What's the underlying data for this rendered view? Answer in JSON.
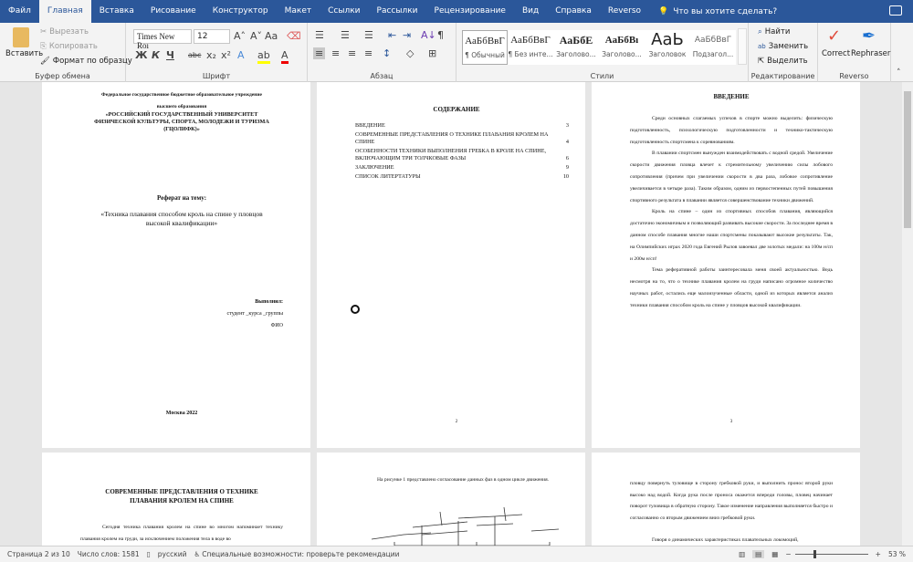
{
  "tabs": [
    "Файл",
    "Главная",
    "Вставка",
    "Рисование",
    "Конструктор",
    "Макет",
    "Ссылки",
    "Рассылки",
    "Рецензирование",
    "Вид",
    "Справка",
    "Reverso"
  ],
  "tell_me": "Что вы хотите сделать?",
  "clipboard": {
    "paste": "Вставить",
    "cut": "Вырезать",
    "copy": "Копировать",
    "format_painter": "Формат по образцу",
    "label": "Буфер обмена"
  },
  "font": {
    "name": "Times New Roı",
    "size": "12",
    "label": "Шрифт",
    "bold": "Ж",
    "italic": "К",
    "underline": "Ч",
    "strike": "abc",
    "sub": "x₂",
    "sup": "x²",
    "grow": "A˄",
    "shrink": "A˅",
    "case": "Aa"
  },
  "paragraph": {
    "label": "Абзац"
  },
  "styles": {
    "label": "Стили",
    "items": [
      {
        "sample": "АаБбВвГ",
        "name": "¶ Обычный"
      },
      {
        "sample": "АаБбВвГ",
        "name": "¶ Без инте..."
      },
      {
        "sample": "АаБбЕ",
        "name": "Заголово..."
      },
      {
        "sample": "АаБбВı",
        "name": "Заголово..."
      },
      {
        "sample": "АаЬ",
        "name": "Заголовок"
      },
      {
        "sample": "АаБбВвГ",
        "name": "Подзагол..."
      }
    ]
  },
  "editing": {
    "label": "Редактирование",
    "find": "Найти",
    "replace": "Заменить",
    "select": "Выделить"
  },
  "reverso": {
    "label": "Reverso",
    "correct": "Correct",
    "rephraser": "Rephraser"
  },
  "page1": {
    "org1": "Федеральное государственное бюджетное образовательное учреждение",
    "org2": "высшего образования",
    "uni1": "«РОССИЙСКИЙ ГОСУДАРСТВЕННЫЙ УНИВЕРСИТЕТ",
    "uni2": "ФИЗИЧЕСКОЙ КУЛЬТУРЫ, СПОРТА, МОЛОДЕЖИ И ТУРИЗМА",
    "uni3": "(ГЦОЛИФК)»",
    "ref": "Реферат на тему:",
    "topic1": "«Техника плавания способом кроль на спине у пловцов",
    "topic2": "высокой квалификации»",
    "done": "Выполнил:",
    "student": "студент _курса _группы",
    "fio": "ФИО",
    "city": "Москва 2022"
  },
  "page2": {
    "title": "СОДЕРЖАНИЕ",
    "toc": [
      {
        "t": "ВВЕДЕНИЕ",
        "p": "3"
      },
      {
        "t": "СОВРЕМЕННЫЕ ПРЕДСТАВЛЕНИЯ О ТЕХНИКЕ ПЛАВАНИЯ КРОЛЕМ НА СПИНЕ",
        "p": "4"
      },
      {
        "t": "ОСОБЕННОСТИ ТЕХНИКИ ВЫПОЛНЕНИЯ ГРЕБКА В КРОЛЕ НА СПИНЕ, ВКЛЮЧАЮЩИМ ТРИ ТОЛЧКОВЫЕ ФАЗЫ",
        "p": "6"
      },
      {
        "t": "ЗАКЛЮЧЕНИЕ",
        "p": "9"
      },
      {
        "t": "СПИСОК ЛИТЕРТАТУРЫ",
        "p": "10"
      }
    ],
    "num": "2"
  },
  "page3": {
    "title": "ВВЕДЕНИЕ",
    "paras": [
      "Среди основных слагаемых успехов в спорте можно выделить: физическую подготовленность, психологическую подготовленности и технико-тактическую подготовленность спортсмена к соревнованиям.",
      "В плавании спортсмен вынужден взаимодействовать с водной средой. Увеличение скорости движения пловца влечет к стремительному увеличению силы лобового сопротивления (причем при увеличении скорости в два раза, лобовое сопротивление увеличивается в четыре раза). Таким образом, одним из первостепенных путей повышения спортивного результата в плавании является совершенствование техники движений.",
      "Кроль на спине – один из спортивных способов плавания, являющийся достаточно экономичным и позволяющий развивать высокие скорости. За последнее время в данном способе плавания многие наши спортсмены показывают высокие результаты. Так, на Олимпийских играх 2020 года Евгений Рылов завоевал две золотых медали: на 100м н/сп и 200м н/сп!",
      "Тема реферативной работы заинтересовала меня своей актуальностью. Ведь несмотря на то, что о технике плавания кролем на груди написано огромное количество научных работ, остались еще малоизученные области, одной из которых является анализ техники плавания способом кроль на спине у пловцов высокой квалификации."
    ],
    "num": "3"
  },
  "page4": {
    "title1": "СОВРЕМЕННЫЕ ПРЕДСТАВЛЕНИЯ О ТЕХНИКЕ",
    "title2": "ПЛАВАНИЯ КРОЛЕМ НА СПИНЕ",
    "para": "Сегодня техника плавания кролем на спине во многом напоминает технику плавания кролем на груди, за исключением положения тела в воде во"
  },
  "page5": {
    "para": "На рисунке 1 представлено согласование данных фаз в одном цикле движения."
  },
  "page6": {
    "para1": "пловцу повернуть туловище в сторону гребковой руки, и выполнить пронос второй руки высоко над водой. Когда рука после проноса окажется впереди головы, пловец начинает поворот туловища в обратную сторону. Такое изменение направления выполняется быстро и согласованно со вторым движением вниз гребковой руки.",
    "para2": "Говоря о динамических характеристиках плавательных локомоций,"
  },
  "status": {
    "page": "Страница 2 из 10",
    "words": "Число слов: 1581",
    "lang": "русский",
    "access": "Специальные возможности: проверьте рекомендации",
    "zoom": "53 %",
    "zoom_level": 53
  }
}
